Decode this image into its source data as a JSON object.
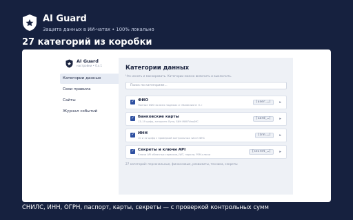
{
  "brand": {
    "title": "AI Guard",
    "subtitle": "Защита данных в ИИ-чатах • 100% локально"
  },
  "headline": "27 категорий из коробки",
  "app": {
    "brand_title": "AI Guard",
    "brand_sub": "настройки • 0.x.1",
    "nav": [
      {
        "label": "Категории данных",
        "active": true
      },
      {
        "label": "Свои правила",
        "active": false
      },
      {
        "label": "Сайты",
        "active": false
      },
      {
        "label": "Журнал событий",
        "active": false
      }
    ],
    "main": {
      "title": "Категории данных",
      "description": "Что искать и маскировать. Категории можно включить и выключить.",
      "search_placeholder": "Поиск по категориям...",
      "categories": [
        {
          "name": "ФИО",
          "desc": "Полные ФИО во всех падежах и «Фамилия И. О.»",
          "tag": "[user_…]",
          "checked": true
        },
        {
          "name": "Банковские карты",
          "desc": "13–19 цифр, алгоритм Луна, БИН МИР/Visa/MC",
          "tag": "[card_…]",
          "checked": true
        },
        {
          "name": "ИНН",
          "desc": "10 и 12 цифр с проверкой контрольных чисел ФНС",
          "tag": "[inn_…]",
          "checked": true
        },
        {
          "name": "Секреты и ключи API",
          "desc": "Ключи API облачных сервисов, JWT, пароли, PEM-ключи",
          "tag": "[secret_…]",
          "checked": true
        }
      ],
      "footer": "27 категорий: персональные, финансовые, реквизиты, техника, секреты"
    }
  },
  "caption": "СНИЛС, ИНН, ОГРН, паспорт, карты, секреты — с проверкой контрольных сумм",
  "colors": {
    "background": "#16213f",
    "accent": "#2d4fa0",
    "panel": "#eef1f6"
  },
  "icons": [
    "shield-star-icon",
    "check-icon",
    "chevron-right-icon"
  ]
}
